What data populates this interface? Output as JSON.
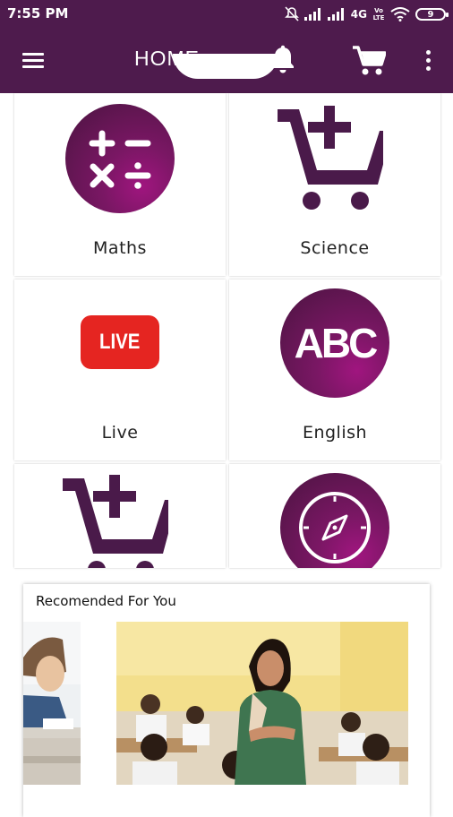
{
  "status_bar": {
    "time": "7:55 PM",
    "network": "4G",
    "volte": "Vo LTE",
    "battery": "9"
  },
  "app_bar": {
    "title": "HOME"
  },
  "categories": [
    {
      "label": "Maths",
      "icon": "math-operations-icon"
    },
    {
      "label": "Science",
      "icon": "cart-plus-icon"
    },
    {
      "label": "Live",
      "icon": "live-badge-icon"
    },
    {
      "label": "English",
      "icon": "abc-icon"
    },
    {
      "label": "",
      "icon": "cart-plus-icon"
    },
    {
      "label": "",
      "icon": "compass-icon"
    }
  ],
  "live_badge_text": "LIVE",
  "abc_text": "ABC",
  "recommended": {
    "title": "Recomended For You"
  },
  "colors": {
    "primary": "#4e1b4d",
    "accent": "#8a1a78",
    "live_red": "#e52521"
  }
}
